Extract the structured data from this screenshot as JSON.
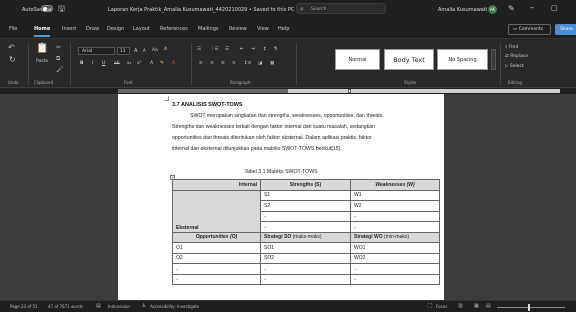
{
  "titlebar": {
    "autosave_label": "AutoSave",
    "autosave_state": "Off",
    "doc_title": "Laporan Kerja Praktik_Amalia Kusumawati_4420210029 • Saved to this PC ∨",
    "search_placeholder": "Search",
    "user_name": "Amalia Kusumawati",
    "user_initials": "AK"
  },
  "menu": {
    "items": [
      "File",
      "Home",
      "Insert",
      "Draw",
      "Design",
      "Layout",
      "References",
      "Mailings",
      "Review",
      "View",
      "Help"
    ],
    "active": "Home",
    "comments_label": "Comments",
    "share_label": "Share"
  },
  "ribbon": {
    "paste_label": "Paste",
    "font_name": "Arial",
    "font_size": "11",
    "undo_label": "Undo",
    "clipboard_label": "Clipboard",
    "font_label": "Font",
    "paragraph_label": "Paragraph",
    "styles_label": "Styles",
    "editing_label": "Editing",
    "styles": [
      "Normal",
      "Body Text",
      "No Spacing"
    ],
    "editing": [
      "Find",
      "Replace",
      "Select"
    ]
  },
  "document": {
    "heading": "3.7   ANALISIS SWOT-TOWS",
    "paragraph_lines": [
      "SWOT merupakan singkatan dari strengths, weaknesses, opportunities, dan threats.",
      "Strengths dan weaknesses terkait dengan faktor internal dari suatu masalah, sedangkan",
      "opportunities dan threats ditentukan oleh faktor eksternal. Dalam aplikasi praktis, faktor",
      "internal dan eksternal ditunjukkan pada matriks SWOT-TOWS berikut[15]."
    ],
    "caption": "Tabel 3.1 Matriks SWOT-TOWS",
    "table": {
      "internal_label": "Internal",
      "strengths_header": "Strengths (S)",
      "weaknesses_header": "Weaknesses (W)",
      "eksternal_label": "Eksternal",
      "s_items": [
        "S1",
        "S2",
        "..",
        ".."
      ],
      "w_items": [
        "W1",
        "W2",
        "..",
        ".."
      ],
      "opportunities_header": "Opportunities (O)",
      "so_header_bold": "Strategi SO",
      "so_header_rest": " (maks-maks)",
      "wo_header_bold": "Strategi WO",
      "wo_header_rest": " (min-maks)",
      "o_items": [
        "O1",
        "O2",
        "..",
        ".."
      ],
      "so_items": [
        "SO1",
        "SO2",
        "..",
        ".."
      ],
      "wo_items": [
        "WO1",
        "WO2",
        "..",
        ".."
      ]
    }
  },
  "status": {
    "page": "Page 23 of 51",
    "words": "47 of 7671 words",
    "language": "Indonesian",
    "accessibility": "Accessibility: Investigate",
    "focus": "Focus"
  }
}
